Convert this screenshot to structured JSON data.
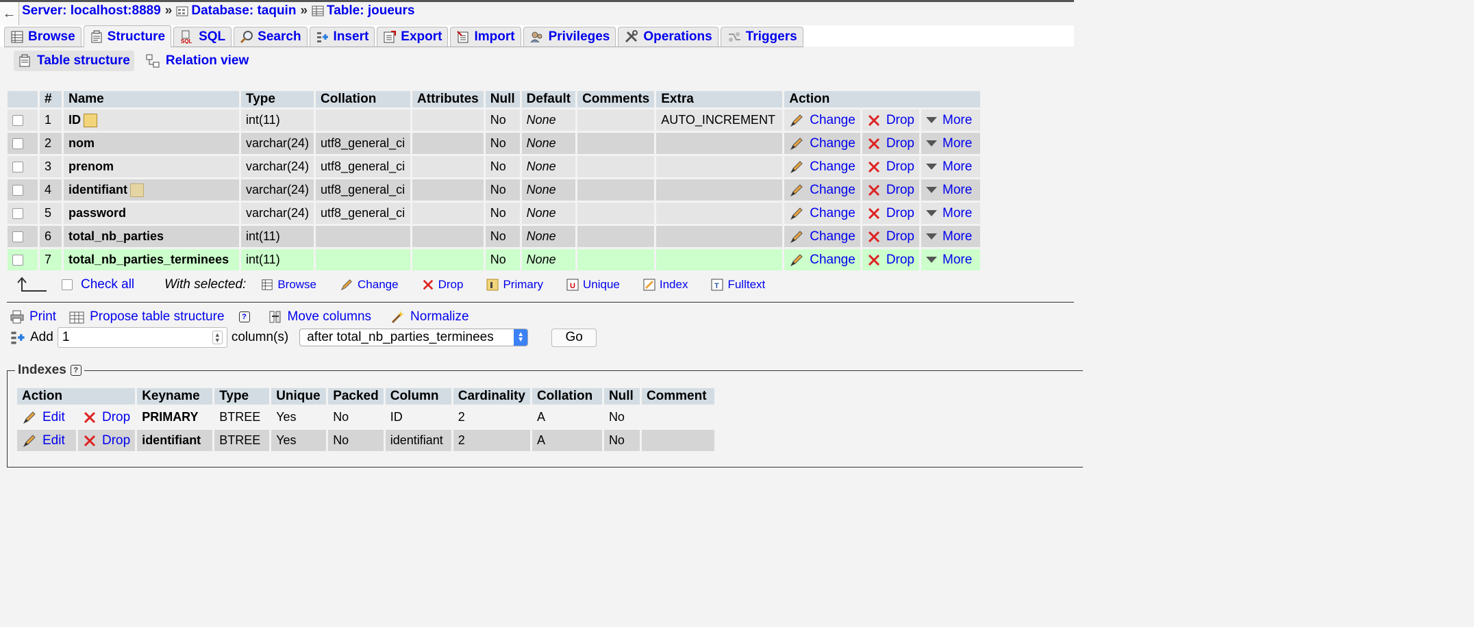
{
  "breadcrumb": {
    "server": "Server: localhost:8889",
    "database": "Database: taquin",
    "table": "Table: joueurs",
    "sep": "»"
  },
  "tabs": [
    {
      "label": "Browse"
    },
    {
      "label": "Structure"
    },
    {
      "label": "SQL"
    },
    {
      "label": "Search"
    },
    {
      "label": "Insert"
    },
    {
      "label": "Export"
    },
    {
      "label": "Import"
    },
    {
      "label": "Privileges"
    },
    {
      "label": "Operations"
    },
    {
      "label": "Triggers"
    }
  ],
  "subtabs": {
    "table_structure": "Table structure",
    "relation_view": "Relation view"
  },
  "structure": {
    "headers": [
      "#",
      "Name",
      "Type",
      "Collation",
      "Attributes",
      "Null",
      "Default",
      "Comments",
      "Extra",
      "Action"
    ],
    "rows": [
      {
        "num": "1",
        "name": "ID",
        "type": "int(11)",
        "collation": "",
        "attributes": "",
        "null": "No",
        "default": "None",
        "comments": "",
        "extra": "AUTO_INCREMENT"
      },
      {
        "num": "2",
        "name": "nom",
        "type": "varchar(24)",
        "collation": "utf8_general_ci",
        "attributes": "",
        "null": "No",
        "default": "None",
        "comments": "",
        "extra": ""
      },
      {
        "num": "3",
        "name": "prenom",
        "type": "varchar(24)",
        "collation": "utf8_general_ci",
        "attributes": "",
        "null": "No",
        "default": "None",
        "comments": "",
        "extra": ""
      },
      {
        "num": "4",
        "name": "identifiant",
        "type": "varchar(24)",
        "collation": "utf8_general_ci",
        "attributes": "",
        "null": "No",
        "default": "None",
        "comments": "",
        "extra": ""
      },
      {
        "num": "5",
        "name": "password",
        "type": "varchar(24)",
        "collation": "utf8_general_ci",
        "attributes": "",
        "null": "No",
        "default": "None",
        "comments": "",
        "extra": ""
      },
      {
        "num": "6",
        "name": "total_nb_parties",
        "type": "int(11)",
        "collation": "",
        "attributes": "",
        "null": "No",
        "default": "None",
        "comments": "",
        "extra": ""
      },
      {
        "num": "7",
        "name": "total_nb_parties_terminees",
        "type": "int(11)",
        "collation": "",
        "attributes": "",
        "null": "No",
        "default": "None",
        "comments": "",
        "extra": ""
      }
    ],
    "actions": {
      "change": "Change",
      "drop": "Drop",
      "more": "More"
    }
  },
  "with_selected": {
    "check_all": "Check all",
    "label": "With selected:",
    "items": [
      "Browse",
      "Change",
      "Drop",
      "Primary",
      "Unique",
      "Index",
      "Fulltext"
    ]
  },
  "tools": {
    "print": "Print",
    "propose": "Propose table structure",
    "move": "Move columns",
    "normalize": "Normalize",
    "add_label": "Add",
    "add_value": "1",
    "columns_label": "column(s)",
    "position_value": "after total_nb_parties_terminees",
    "go": "Go"
  },
  "indexes": {
    "legend": "Indexes",
    "headers": [
      "Action",
      "Keyname",
      "Type",
      "Unique",
      "Packed",
      "Column",
      "Cardinality",
      "Collation",
      "Null",
      "Comment"
    ],
    "edit": "Edit",
    "drop": "Drop",
    "rows": [
      {
        "keyname": "PRIMARY",
        "type": "BTREE",
        "unique": "Yes",
        "packed": "No",
        "column": "ID",
        "cardinality": "2",
        "collation": "A",
        "null": "No",
        "comment": ""
      },
      {
        "keyname": "identifiant",
        "type": "BTREE",
        "unique": "Yes",
        "packed": "No",
        "column": "identifiant",
        "cardinality": "2",
        "collation": "A",
        "null": "No",
        "comment": ""
      }
    ]
  },
  "colors": {
    "link": "#0000ee",
    "header_bg": "#d3dce3",
    "highlight_row": "#ccffcc"
  }
}
